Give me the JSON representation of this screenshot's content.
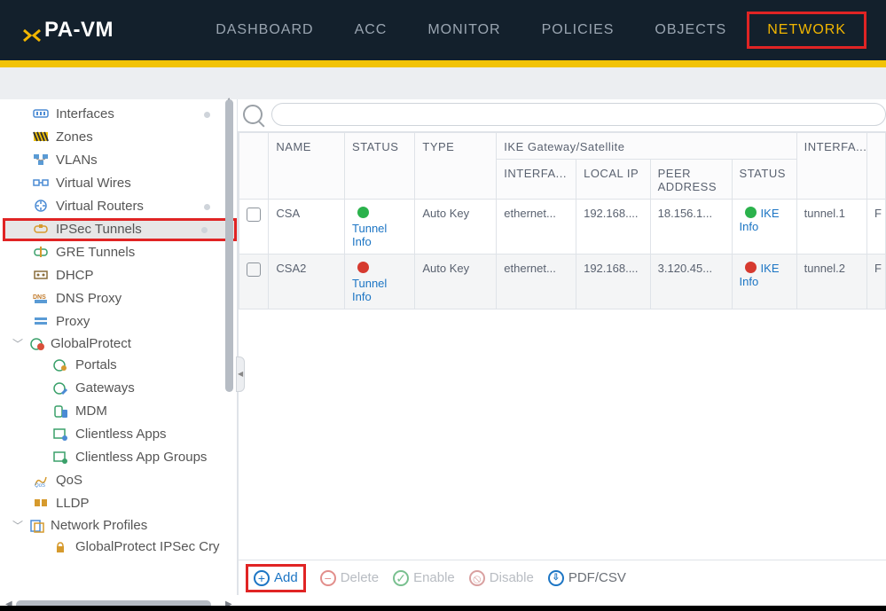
{
  "header": {
    "logo_text": "PA-VM",
    "nav": [
      "DASHBOARD",
      "ACC",
      "MONITOR",
      "POLICIES",
      "OBJECTS",
      "NETWORK"
    ],
    "active_nav": "NETWORK"
  },
  "sidebar": {
    "items": [
      {
        "label": "Interfaces",
        "dot": true
      },
      {
        "label": "Zones"
      },
      {
        "label": "VLANs"
      },
      {
        "label": "Virtual Wires"
      },
      {
        "label": "Virtual Routers",
        "dot": true
      },
      {
        "label": "IPSec Tunnels",
        "selected": true,
        "dot": true,
        "highlighted": true
      },
      {
        "label": "GRE Tunnels"
      },
      {
        "label": "DHCP"
      },
      {
        "label": "DNS Proxy"
      },
      {
        "label": "Proxy"
      }
    ],
    "globalprotect": {
      "label": "GlobalProtect",
      "children": [
        "Portals",
        "Gateways",
        "MDM",
        "Clientless Apps",
        "Clientless App Groups"
      ]
    },
    "items2": [
      {
        "label": "QoS"
      },
      {
        "label": "LLDP"
      }
    ],
    "netprofiles": {
      "label": "Network Profiles",
      "children": [
        "GlobalProtect IPSec Cry"
      ]
    }
  },
  "table": {
    "group_header": "IKE Gateway/Satellite",
    "columns": {
      "name": "NAME",
      "status": "STATUS",
      "type": "TYPE",
      "interfa": "INTERFA...",
      "localip": "LOCAL IP",
      "peer": "PEER ADDRESS",
      "status2": "STATUS",
      "interfb": "INTERFA..."
    },
    "rows": [
      {
        "name": "CSA",
        "status_color": "green",
        "status_link": "Tunnel Info",
        "type": "Auto Key",
        "interfa": "ethernet...",
        "localip": "192.168....",
        "peer": "18.156.1...",
        "ike_color": "green",
        "ike_label": "IKE",
        "ike_link": "Info",
        "interfb": "tunnel.1",
        "trail": "F"
      },
      {
        "name": "CSA2",
        "status_color": "red",
        "status_link": "Tunnel Info",
        "type": "Auto Key",
        "interfa": "ethernet...",
        "localip": "192.168....",
        "peer": "3.120.45...",
        "ike_color": "red",
        "ike_label": "IKE",
        "ike_link": "Info",
        "interfb": "tunnel.2",
        "trail": "F"
      }
    ]
  },
  "footer": {
    "add": "Add",
    "delete": "Delete",
    "enable": "Enable",
    "disable": "Disable",
    "pdfcsv": "PDF/CSV"
  },
  "search": {
    "placeholder": ""
  }
}
